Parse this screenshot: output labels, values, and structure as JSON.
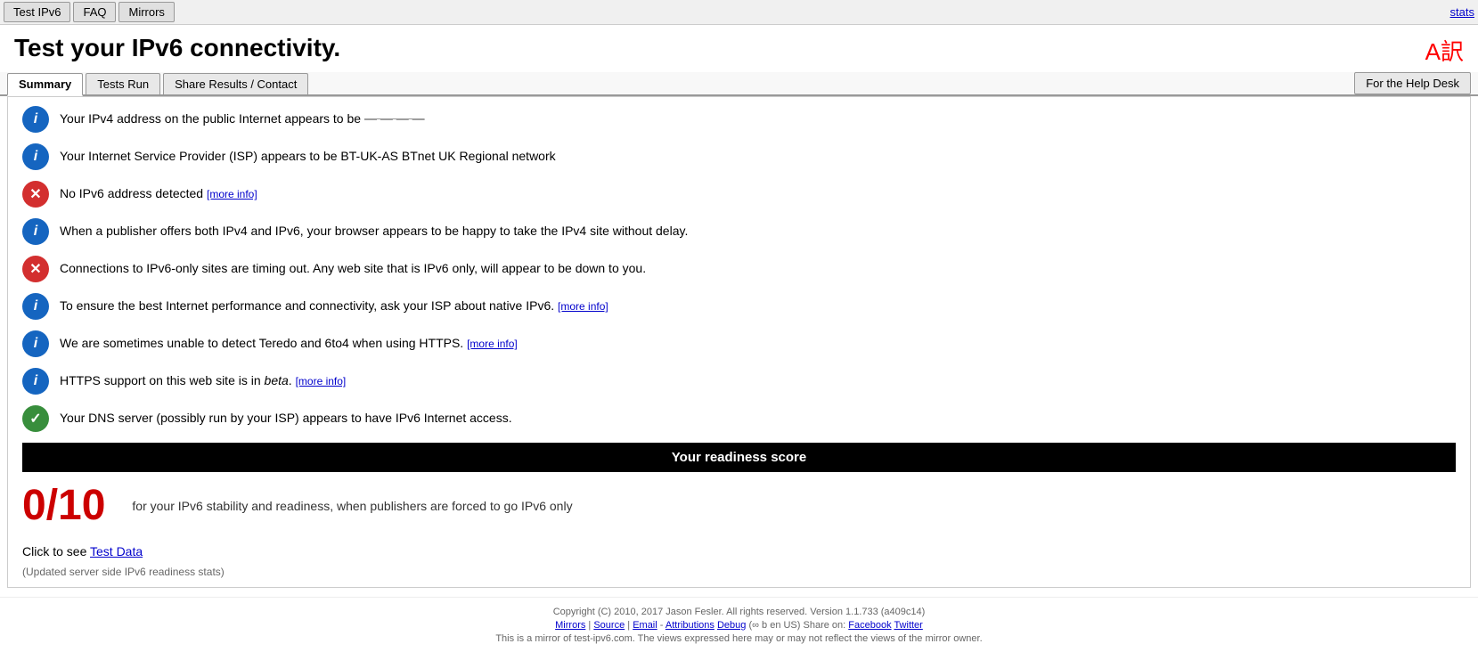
{
  "nav": {
    "tab1": "Test IPv6",
    "tab2": "FAQ",
    "tab3": "Mirrors",
    "stats": "stats"
  },
  "page": {
    "title": "Test your IPv6 connectivity.",
    "translate_icon": "A訳"
  },
  "tabs": {
    "summary": "Summary",
    "tests_run": "Tests Run",
    "share_results": "Share Results / Contact",
    "help_desk": "For the Help Desk",
    "active": "summary"
  },
  "rows": [
    {
      "icon_type": "info",
      "text": "Your IPv4 address on the public Internet appears to be ",
      "link": null
    },
    {
      "icon_type": "info",
      "text": "Your Internet Service Provider (ISP) appears to be BT-UK-AS BTnet UK Regional network",
      "link": null
    },
    {
      "icon_type": "error",
      "text": "No IPv6 address detected ",
      "link": "[more info]"
    },
    {
      "icon_type": "info",
      "text": "When a publisher offers both IPv4 and IPv6, your browser appears to be happy to take the IPv4 site without delay.",
      "link": null
    },
    {
      "icon_type": "error",
      "text": "Connections to IPv6-only sites are timing out. Any web site that is IPv6 only, will appear to be down to you.",
      "link": null
    },
    {
      "icon_type": "info",
      "text": "To ensure the best Internet performance and connectivity, ask your ISP about native IPv6. ",
      "link": "[more info]"
    },
    {
      "icon_type": "info",
      "text": "We are sometimes unable to detect Teredo and 6to4 when using HTTPS. ",
      "link": "[more info]"
    },
    {
      "icon_type": "info",
      "text": "HTTPS support on this web site is in ",
      "italic": "beta",
      "text2": ". ",
      "link": "[more info]"
    },
    {
      "icon_type": "success",
      "text": "Your DNS server (possibly run by your ISP) appears to have IPv6 Internet access.",
      "link": null
    }
  ],
  "score": {
    "bar_title": "Your readiness score",
    "subtitle": "for your IPv6 stability and readiness, when publishers are forced to go IPv6 only",
    "number": "0/10"
  },
  "test_data": {
    "label": "Click to see ",
    "link_text": "Test Data"
  },
  "updated_note": "(Updated server side IPv6 readiness stats)",
  "footer": {
    "copyright": "Copyright (C) 2010, 2017 Jason Fesler. All rights reserved. Version 1.1.733 (a409c14)",
    "links_line": "Mirrors | Source | Email  -  Attributions  Debug  (∞ b en  US ) Share on: Facebook  Twitter",
    "mirror_note": "This is a mirror of test-ipv6.com. The views expressed here may or may not reflect the views of the mirror owner."
  }
}
